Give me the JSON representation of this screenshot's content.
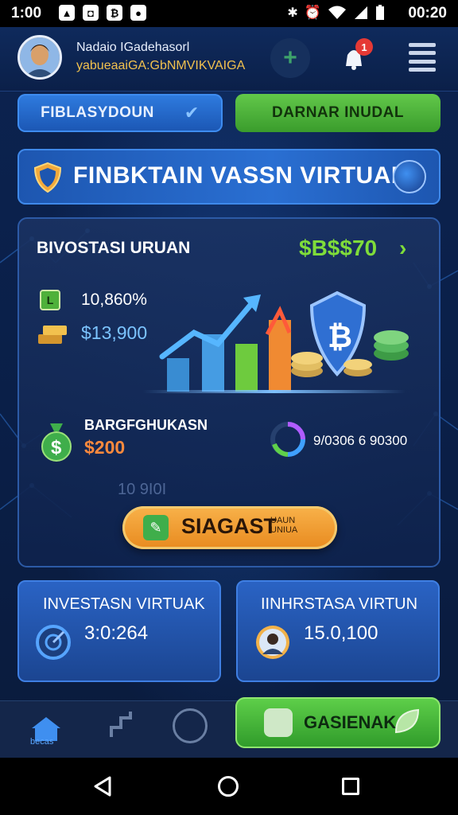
{
  "status_bar": {
    "time": "1:00",
    "clock": "00:20"
  },
  "header": {
    "user_name": "Nadaio IGadehasorl",
    "user_subtitle": "yabueaaiGA:GbNMVIKVAIGA",
    "notification_count": "1"
  },
  "tabs": {
    "left_label": "FIBLASYDOUN",
    "right_label": "DARNAR INUDAL"
  },
  "banner": {
    "title": "FINBKTAIN VASSN VIRTUAL"
  },
  "card": {
    "title": "BIVOSTASI URUAN",
    "amount": "$B$$70",
    "stat1_icon_text": "L",
    "stat1_value": "10,860%",
    "stat2_value": "$13,900",
    "savings_label": "BARGFGHUKASN",
    "savings_value": "$200",
    "ring_value": "9/0306 6 90300",
    "faint_text": "10 9I0I",
    "cta_label": "SIAGAST",
    "cta_small": "UAUN UNIUA"
  },
  "mini_left": {
    "title": "INVESTASN VIRTUAK",
    "value": "3:0:264"
  },
  "mini_right": {
    "title": "IINHRSTASA VIRTUN",
    "value": "15.0,100"
  },
  "bottom_nav": {
    "home_label": "becas",
    "cta_label": "GASIENAK"
  },
  "colors": {
    "accent_green": "#7fdc3a",
    "accent_blue": "#2a6fd2",
    "accent_orange": "#f8b24a"
  }
}
